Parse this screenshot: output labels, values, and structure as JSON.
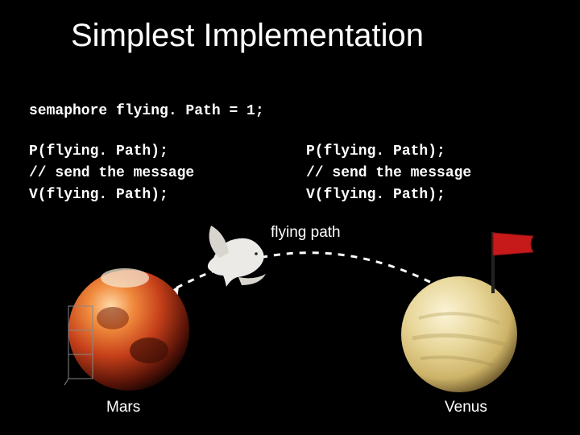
{
  "title": "Simplest Implementation",
  "decl": "semaphore flying. Path = 1;",
  "left": {
    "l1": "P(flying. Path);",
    "l2": "// send the message",
    "l3": "V(flying. Path);"
  },
  "right": {
    "l1": "P(flying. Path);",
    "l2": "// send the message",
    "l3": "V(flying. Path);"
  },
  "pathLabel": "flying path",
  "marsLabel": "Mars",
  "venusLabel": "Venus"
}
